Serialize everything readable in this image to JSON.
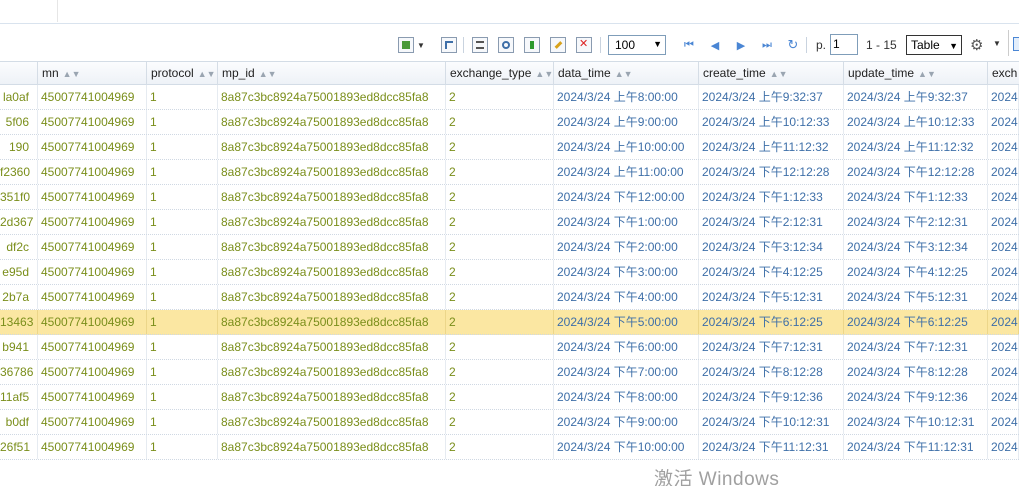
{
  "toolbar": {
    "page_size": "100",
    "page_label": "p.",
    "page_number": "1",
    "range_text": "1 - 15",
    "view_mode": "Table"
  },
  "grid": {
    "columns": [
      "mn",
      "protocol",
      "mp_id",
      "exchange_type",
      "data_time",
      "create_time",
      "update_time",
      "exch"
    ],
    "rows": [
      {
        "id_tail": "la0af",
        "mn": "45007741004969",
        "protocol": "1",
        "mp_id": "8a87c3bc8924a75001893ed8dcc85fa8",
        "exchange_type": "2",
        "data_time": "2024/3/24 上午8:00:00",
        "create_time": "2024/3/24 上午9:32:37",
        "update_time": "2024/3/24 上午9:32:37",
        "exch": "2024"
      },
      {
        "id_tail": "5f06",
        "mn": "45007741004969",
        "protocol": "1",
        "mp_id": "8a87c3bc8924a75001893ed8dcc85fa8",
        "exchange_type": "2",
        "data_time": "2024/3/24 上午9:00:00",
        "create_time": "2024/3/24 上午10:12:33",
        "update_time": "2024/3/24 上午10:12:33",
        "exch": "2024"
      },
      {
        "id_tail": "190",
        "mn": "45007741004969",
        "protocol": "1",
        "mp_id": "8a87c3bc8924a75001893ed8dcc85fa8",
        "exchange_type": "2",
        "data_time": "2024/3/24 上午10:00:00",
        "create_time": "2024/3/24 上午11:12:32",
        "update_time": "2024/3/24 上午11:12:32",
        "exch": "2024"
      },
      {
        "id_tail": "f2360",
        "mn": "45007741004969",
        "protocol": "1",
        "mp_id": "8a87c3bc8924a75001893ed8dcc85fa8",
        "exchange_type": "2",
        "data_time": "2024/3/24 上午11:00:00",
        "create_time": "2024/3/24 下午12:12:28",
        "update_time": "2024/3/24 下午12:12:28",
        "exch": "2024"
      },
      {
        "id_tail": "351f0",
        "mn": "45007741004969",
        "protocol": "1",
        "mp_id": "8a87c3bc8924a75001893ed8dcc85fa8",
        "exchange_type": "2",
        "data_time": "2024/3/24 下午12:00:00",
        "create_time": "2024/3/24 下午1:12:33",
        "update_time": "2024/3/24 下午1:12:33",
        "exch": "2024"
      },
      {
        "id_tail": "2d367",
        "mn": "45007741004969",
        "protocol": "1",
        "mp_id": "8a87c3bc8924a75001893ed8dcc85fa8",
        "exchange_type": "2",
        "data_time": "2024/3/24 下午1:00:00",
        "create_time": "2024/3/24 下午2:12:31",
        "update_time": "2024/3/24 下午2:12:31",
        "exch": "2024"
      },
      {
        "id_tail": "df2c",
        "mn": "45007741004969",
        "protocol": "1",
        "mp_id": "8a87c3bc8924a75001893ed8dcc85fa8",
        "exchange_type": "2",
        "data_time": "2024/3/24 下午2:00:00",
        "create_time": "2024/3/24 下午3:12:34",
        "update_time": "2024/3/24 下午3:12:34",
        "exch": "2024"
      },
      {
        "id_tail": "e95d",
        "mn": "45007741004969",
        "protocol": "1",
        "mp_id": "8a87c3bc8924a75001893ed8dcc85fa8",
        "exchange_type": "2",
        "data_time": "2024/3/24 下午3:00:00",
        "create_time": "2024/3/24 下午4:12:25",
        "update_time": "2024/3/24 下午4:12:25",
        "exch": "2024"
      },
      {
        "id_tail": "2b7a",
        "mn": "45007741004969",
        "protocol": "1",
        "mp_id": "8a87c3bc8924a75001893ed8dcc85fa8",
        "exchange_type": "2",
        "data_time": "2024/3/24 下午4:00:00",
        "create_time": "2024/3/24 下午5:12:31",
        "update_time": "2024/3/24 下午5:12:31",
        "exch": "2024"
      },
      {
        "id_tail": "13463",
        "mn": "45007741004969",
        "protocol": "1",
        "mp_id": "8a87c3bc8924a75001893ed8dcc85fa8",
        "exchange_type": "2",
        "data_time": "2024/3/24 下午5:00:00",
        "create_time": "2024/3/24 下午6:12:25",
        "update_time": "2024/3/24 下午6:12:25",
        "exch": "2024",
        "selected": true
      },
      {
        "id_tail": "b941",
        "mn": "45007741004969",
        "protocol": "1",
        "mp_id": "8a87c3bc8924a75001893ed8dcc85fa8",
        "exchange_type": "2",
        "data_time": "2024/3/24 下午6:00:00",
        "create_time": "2024/3/24 下午7:12:31",
        "update_time": "2024/3/24 下午7:12:31",
        "exch": "2024"
      },
      {
        "id_tail": "36786",
        "mn": "45007741004969",
        "protocol": "1",
        "mp_id": "8a87c3bc8924a75001893ed8dcc85fa8",
        "exchange_type": "2",
        "data_time": "2024/3/24 下午7:00:00",
        "create_time": "2024/3/24 下午8:12:28",
        "update_time": "2024/3/24 下午8:12:28",
        "exch": "2024"
      },
      {
        "id_tail": "11af5",
        "mn": "45007741004969",
        "protocol": "1",
        "mp_id": "8a87c3bc8924a75001893ed8dcc85fa8",
        "exchange_type": "2",
        "data_time": "2024/3/24 下午8:00:00",
        "create_time": "2024/3/24 下午9:12:36",
        "update_time": "2024/3/24 下午9:12:36",
        "exch": "2024"
      },
      {
        "id_tail": "b0df",
        "mn": "45007741004969",
        "protocol": "1",
        "mp_id": "8a87c3bc8924a75001893ed8dcc85fa8",
        "exchange_type": "2",
        "data_time": "2024/3/24 下午9:00:00",
        "create_time": "2024/3/24 下午10:12:31",
        "update_time": "2024/3/24 下午10:12:31",
        "exch": "2024"
      },
      {
        "id_tail": "26f51",
        "mn": "45007741004969",
        "protocol": "1",
        "mp_id": "8a87c3bc8924a75001893ed8dcc85fa8",
        "exchange_type": "2",
        "data_time": "2024/3/24 下午10:00:00",
        "create_time": "2024/3/24 下午11:12:31",
        "update_time": "2024/3/24 下午11:12:31",
        "exch": "2024"
      }
    ]
  },
  "watermark": "激活 Windows",
  "colors": {
    "green_text": "#7a8e1a",
    "blue_text": "#3e6fa8",
    "selected_row": "#fbe7a2"
  }
}
